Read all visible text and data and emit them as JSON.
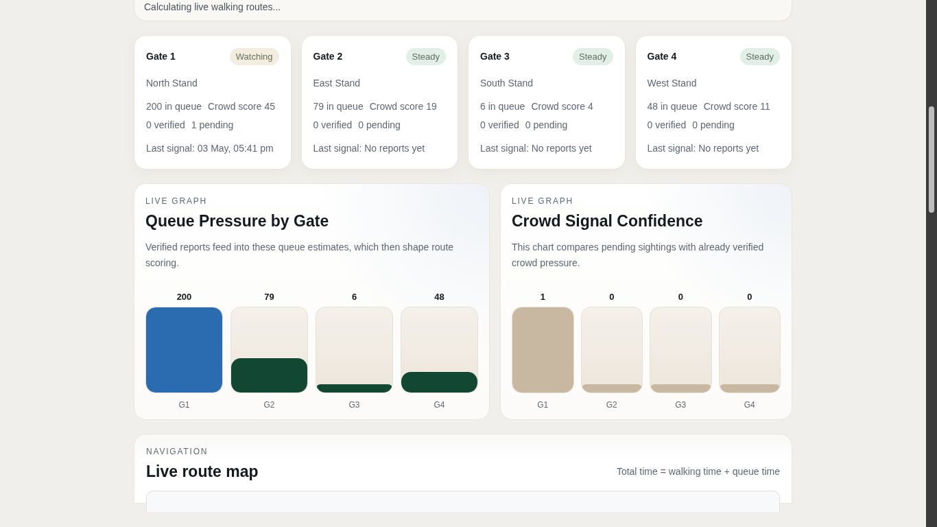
{
  "status_card": {
    "message": "Calculating live walking routes..."
  },
  "gates": [
    {
      "name": "Gate 1",
      "badge": {
        "label": "Watching",
        "color": "#f3ede0"
      },
      "stand": "North Stand",
      "queue": "200 in queue",
      "crowd_score": "Crowd score 45",
      "verified": "0 verified",
      "pending": "1 pending",
      "last_signal": "Last signal: 03 May, 05:41 pm"
    },
    {
      "name": "Gate 2",
      "badge": {
        "label": "Steady",
        "color": "#e1efe8"
      },
      "stand": "East Stand",
      "queue": "79 in queue",
      "crowd_score": "Crowd score 19",
      "verified": "0 verified",
      "pending": "0 pending",
      "last_signal": "Last signal: No reports yet"
    },
    {
      "name": "Gate 3",
      "badge": {
        "label": "Steady",
        "color": "#e1efe8"
      },
      "stand": "South Stand",
      "queue": "6 in queue",
      "crowd_score": "Crowd score 4",
      "verified": "0 verified",
      "pending": "0 pending",
      "last_signal": "Last signal: No reports yet"
    },
    {
      "name": "Gate 4",
      "badge": {
        "label": "Steady",
        "color": "#e1efe8"
      },
      "stand": "West Stand",
      "queue": "48 in queue",
      "crowd_score": "Crowd score 11",
      "verified": "0 verified",
      "pending": "0 pending",
      "last_signal": "Last signal: No reports yet"
    }
  ],
  "graphs": [
    {
      "eyebrow": "LIVE GRAPH",
      "title": "Queue Pressure by Gate",
      "description": "Verified reports feed into these queue estimates, which then shape route scoring.",
      "bars": [
        {
          "value": "200",
          "label": "G1",
          "level": 1,
          "color": "#2b6cb0"
        },
        {
          "value": "79",
          "label": "G2",
          "level": 0.4,
          "color": "#124734"
        },
        {
          "value": "6",
          "label": "G3",
          "level": 0.1,
          "color": "#124734"
        },
        {
          "value": "48",
          "label": "G4",
          "level": 0.24,
          "color": "#124734"
        }
      ]
    },
    {
      "eyebrow": "LIVE GRAPH",
      "title": "Crowd Signal Confidence",
      "description": "This chart compares pending sightings with already verified crowd pressure.",
      "bars": [
        {
          "value": "1",
          "label": "G1",
          "level": 1,
          "color": "#c8b8a2"
        },
        {
          "value": "0",
          "label": "G2",
          "level": 0.1,
          "color": "#c8b8a2"
        },
        {
          "value": "0",
          "label": "G3",
          "level": 0.1,
          "color": "#c8b8a2"
        },
        {
          "value": "0",
          "label": "G4",
          "level": 0.1,
          "color": "#c8b8a2"
        }
      ]
    }
  ],
  "navigation": {
    "eyebrow": "NAVIGATION",
    "title": "Live route map",
    "formula": "Total time = walking time + queue time"
  }
}
